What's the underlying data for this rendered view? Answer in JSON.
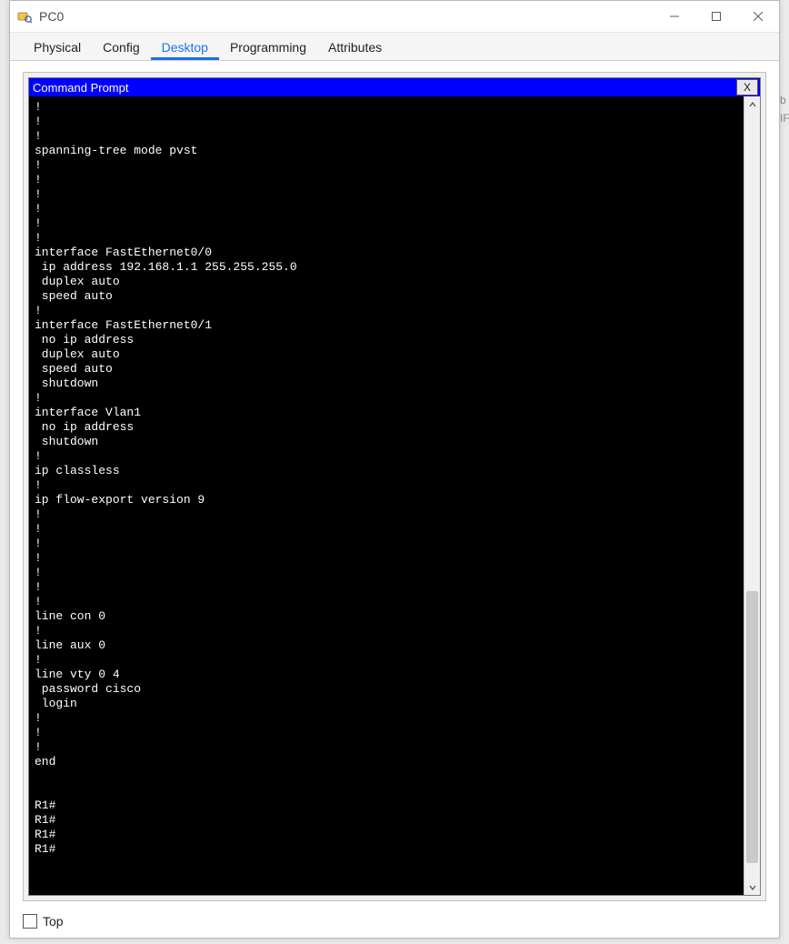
{
  "window": {
    "title": "PC0"
  },
  "tabs": [
    {
      "label": "Physical",
      "active": false
    },
    {
      "label": "Config",
      "active": false
    },
    {
      "label": "Desktop",
      "active": true
    },
    {
      "label": "Programming",
      "active": false
    },
    {
      "label": "Attributes",
      "active": false
    }
  ],
  "command_prompt": {
    "title": "Command Prompt",
    "close_label": "X",
    "lines": [
      "!",
      "!",
      "!",
      "spanning-tree mode pvst",
      "!",
      "!",
      "!",
      "!",
      "!",
      "!",
      "interface FastEthernet0/0",
      " ip address 192.168.1.1 255.255.255.0",
      " duplex auto",
      " speed auto",
      "!",
      "interface FastEthernet0/1",
      " no ip address",
      " duplex auto",
      " speed auto",
      " shutdown",
      "!",
      "interface Vlan1",
      " no ip address",
      " shutdown",
      "!",
      "ip classless",
      "!",
      "ip flow-export version 9",
      "!",
      "!",
      "!",
      "!",
      "!",
      "!",
      "!",
      "line con 0",
      "!",
      "line aux 0",
      "!",
      "line vty 0 4",
      " password cisco",
      " login",
      "!",
      "!",
      "!",
      "end",
      "",
      "",
      "R1#",
      "R1#",
      "R1#",
      "R1#"
    ]
  },
  "footer": {
    "top_label": "Top",
    "top_checked": false
  },
  "bg_peek": [
    "b",
    "IF"
  ]
}
